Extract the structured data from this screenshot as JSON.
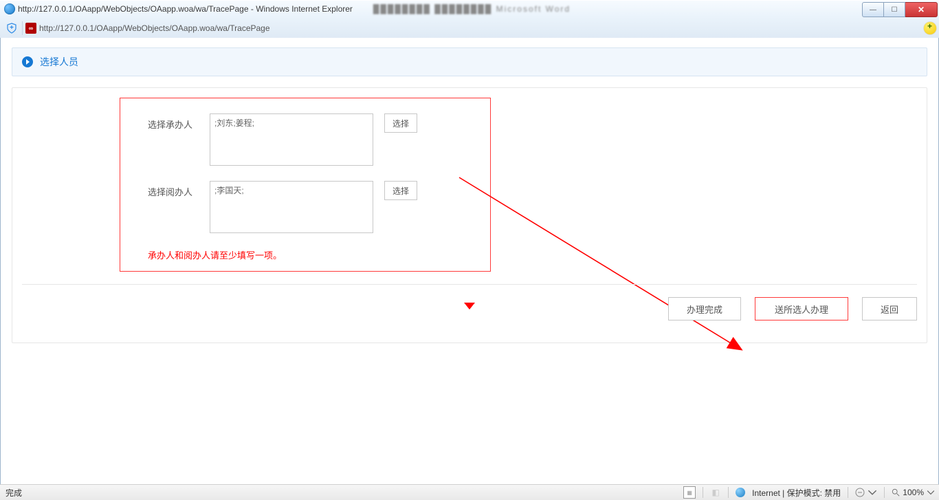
{
  "window": {
    "title": "http://127.0.0.1/OAapp/WebObjects/OAapp.woa/wa/TracePage - Windows Internet Explorer",
    "background_fragment": "████████     ████████     Microsoft Word"
  },
  "address_bar": {
    "url": "http://127.0.0.1/OAapp/WebObjects/OAapp.woa/wa/TracePage",
    "favicon_text": "∞"
  },
  "panel": {
    "title": "选择人员"
  },
  "form": {
    "row1": {
      "label": "选择承办人",
      "value": ";刘东;姜程;",
      "select_btn": "选择"
    },
    "row2": {
      "label": "选择阅办人",
      "value": ";李国天;",
      "select_btn": "选择"
    },
    "hint": "承办人和阅办人请至少填写一项。"
  },
  "footer": {
    "complete": "办理完成",
    "send": "送所选人办理",
    "back": "返回"
  },
  "statusbar": {
    "left": "完成",
    "zone": "Internet | 保护模式: 禁用",
    "zoom": "100%"
  },
  "colors": {
    "accent_blue": "#1678d3",
    "alert_red": "#ff3a3a"
  }
}
